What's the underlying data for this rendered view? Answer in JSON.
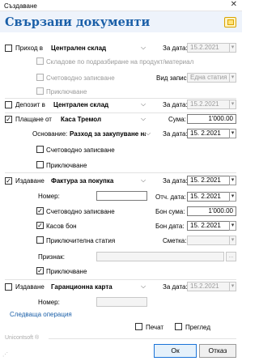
{
  "window": {
    "title": "Създаване",
    "close_icon": "close-icon"
  },
  "header": {
    "title": "Свързани документи"
  },
  "prihod": {
    "label": "Приход в",
    "target": "Централен склад",
    "date_label": "За дата:",
    "date": "15.2.2021",
    "sub1": "Складове по подразбиране на продукт/материал",
    "sub2": "Счетоводно записване",
    "sub3": "Приключване",
    "vid_label": "Вид запис:",
    "vid_value": "Една статия"
  },
  "deposit": {
    "label": "Депозит в",
    "target": "Централен склад",
    "date_label": "За дата:",
    "date": "15.2.2021"
  },
  "payment": {
    "label": "Плащане от",
    "target": "Каса Тремол",
    "suma_label": "Сума:",
    "suma": "1'000.00",
    "osnovanie_label": "Основание:",
    "osnovanie": "Разход за закупуване на с",
    "date_label": "За дата:",
    "date": "15.  2.2021",
    "accounting": "Счетоводно записване",
    "closing": "Приключване",
    "check_mark": "✓"
  },
  "invoice": {
    "label": "Издаване",
    "target": "Фактура за покупка",
    "date_label": "За дата:",
    "date": "15.  2.2021",
    "nomer_label": "Номер:",
    "nomer": "",
    "otch_label": "Отч. дата:",
    "otch_date": "15.  2.2021",
    "accounting": "Счетоводно записване",
    "bon_suma_label": "Бон сума:",
    "bon_suma": "1'000.00",
    "kasov_bon": "Касов бон",
    "bon_date_label": "Бон дата:",
    "bon_date": "15.  2.2021",
    "closing_article": "Приключителна статия",
    "smetka_label": "Сметка:",
    "smetka": "",
    "priznak_label": "Признак:",
    "priznak": "",
    "browse": "...",
    "closing": "Приключване"
  },
  "warranty": {
    "label": "Издаване",
    "target": "Гаранционна карта",
    "date_label": "За дата:",
    "date": "15.2.2021",
    "nomer_label": "Номер:",
    "nomer": ""
  },
  "next_operation": "Следваща операция",
  "brand": "Unicontsoft ®",
  "print_label": "Печат",
  "preview_label": "Преглед",
  "ok_label": "Ок",
  "cancel_label": "Отказ",
  "dropdown_glyph": "▾",
  "chevron_glyph": "⌵"
}
